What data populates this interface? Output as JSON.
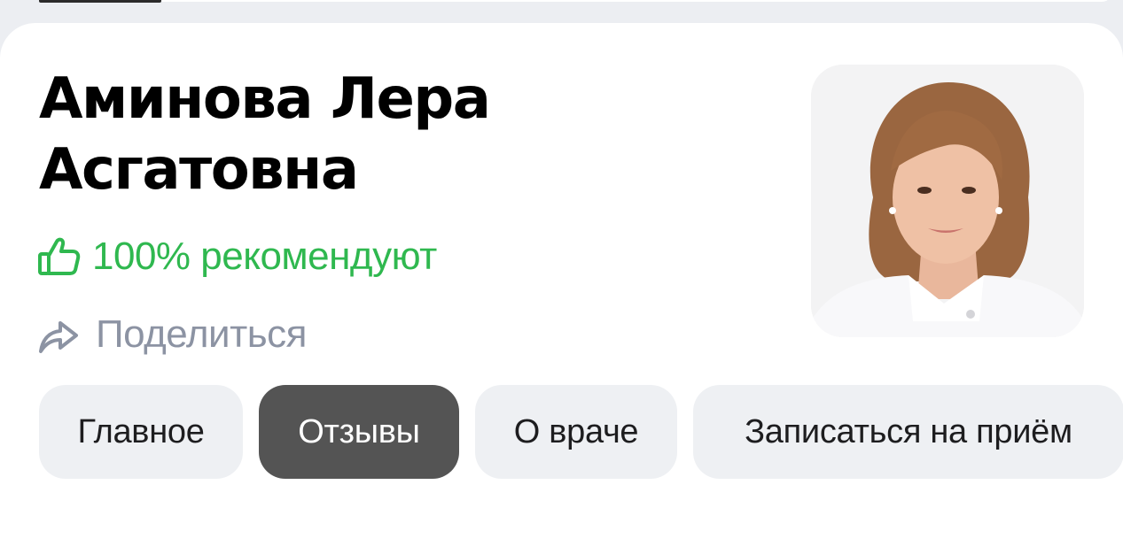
{
  "doctor": {
    "name_line1": "Аминова Лера",
    "name_line2": "Асгатовна",
    "recommend_text": "100% рекомендуют",
    "photo_icon": "doctor-portrait"
  },
  "actions": {
    "share_label": "Поделиться",
    "share_icon": "share-arrow-icon",
    "recommend_icon": "thumbs-up-icon"
  },
  "tabs": [
    {
      "label": "Главное",
      "active": false
    },
    {
      "label": "Отзывы",
      "active": true
    },
    {
      "label": "О враче",
      "active": false
    },
    {
      "label": "Записаться на приём",
      "active": false
    }
  ],
  "colors": {
    "recommend_green": "#2fb84f",
    "share_gray": "#8c93a3",
    "active_tab_bg": "#545454",
    "tab_bg": "#eef0f3",
    "page_bg": "#eceef2"
  }
}
